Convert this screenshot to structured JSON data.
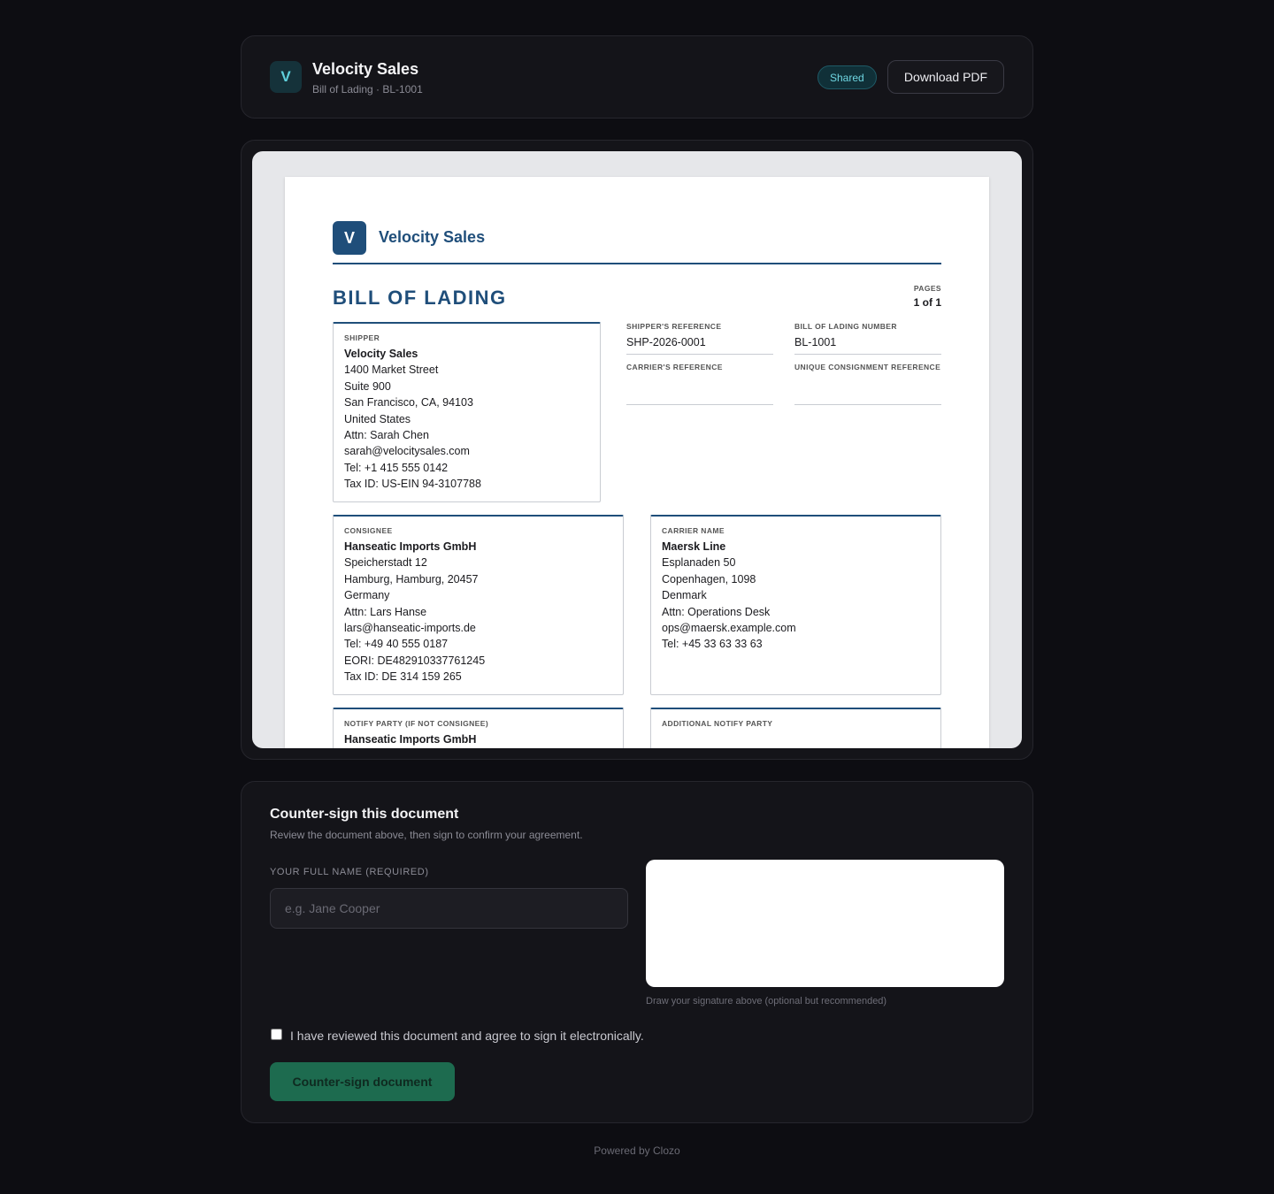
{
  "header": {
    "logo_letter": "V",
    "company": "Velocity Sales",
    "subtitle": "Bill of Lading · BL-1001",
    "badge": "Shared",
    "download_label": "Download PDF"
  },
  "document": {
    "logo_letter": "V",
    "brand": "Velocity Sales",
    "title": "BILL OF LADING",
    "pages_label": "PAGES",
    "pages_value": "1 of 1",
    "shipper": {
      "label": "SHIPPER",
      "name": "Velocity Sales",
      "lines": [
        "1400 Market Street",
        "Suite 900",
        "San Francisco, CA, 94103",
        "United States",
        "Attn: Sarah Chen",
        "sarah@velocitysales.com",
        "Tel: +1 415 555 0142",
        "Tax ID: US-EIN 94-3107788"
      ]
    },
    "shipper_reference": {
      "label": "SHIPPER'S REFERENCE",
      "value": "SHP-2026-0001"
    },
    "bill_of_lading_number": {
      "label": "BILL OF LADING NUMBER",
      "value": "BL-1001"
    },
    "carrier_reference": {
      "label": "CARRIER'S REFERENCE",
      "value": ""
    },
    "unique_consignment_reference": {
      "label": "UNIQUE CONSIGNMENT REFERENCE",
      "value": ""
    },
    "consignee": {
      "label": "CONSIGNEE",
      "name": "Hanseatic Imports GmbH",
      "lines": [
        "Speicherstadt 12",
        "Hamburg, Hamburg, 20457",
        "Germany",
        "Attn: Lars Hanse",
        "lars@hanseatic-imports.de",
        "Tel: +49 40 555 0187",
        "EORI: DE482910337761245",
        "Tax ID: DE 314 159 265"
      ]
    },
    "carrier": {
      "label": "CARRIER NAME",
      "name": "Maersk Line",
      "lines": [
        "Esplanaden 50",
        "Copenhagen, 1098",
        "Denmark",
        "Attn: Operations Desk",
        "ops@maersk.example.com",
        "Tel: +45 33 63 33 63"
      ]
    },
    "notify_party": {
      "label": "NOTIFY PARTY (IF NOT CONSIGNEE)",
      "name": "Hanseatic Imports GmbH"
    },
    "additional_notify_party": {
      "label": "ADDITIONAL NOTIFY PARTY"
    }
  },
  "sign": {
    "heading": "Counter-sign this document",
    "description": "Review the document above, then sign to confirm your agreement.",
    "name_label": "YOUR FULL NAME (REQUIRED)",
    "name_placeholder": "e.g. Jane Cooper",
    "name_value": "",
    "pad_hint": "Draw your signature above (optional but recommended)",
    "agree_label": "I have reviewed this document and agree to sign it electronically.",
    "agree_checked": false,
    "submit_label": "Counter-sign document"
  },
  "footer": {
    "text": "Powered by Clozo"
  },
  "colors": {
    "background": "#0d0d12",
    "card": "#141419",
    "document_accent": "#1f4e7a",
    "badge_text": "#6fd6e2",
    "submit_button": "#1d6b4f"
  }
}
